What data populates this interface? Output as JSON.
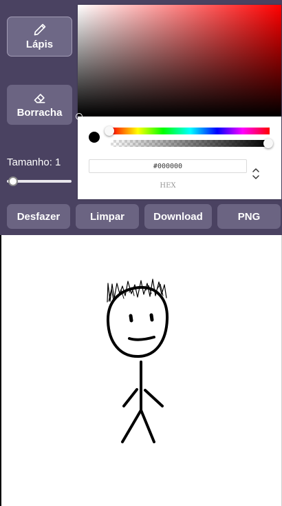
{
  "tools": {
    "pencil": {
      "label": "Lápis",
      "icon": "pencil-icon",
      "active": true
    },
    "eraser": {
      "label": "Borracha",
      "icon": "eraser-icon",
      "active": false
    }
  },
  "size": {
    "label": "Tamanho: 1",
    "value": 1
  },
  "picker": {
    "hex_value": "#000000",
    "mode_label": "HEX",
    "current_color": "#000000",
    "hue_color": "#ff0000"
  },
  "actions": {
    "undo": "Desfazer",
    "clear": "Limpar",
    "download": "Download",
    "format": "PNG"
  },
  "theme": {
    "toolbar_bg": "#4a4261",
    "button_bg": "#6b6482"
  }
}
